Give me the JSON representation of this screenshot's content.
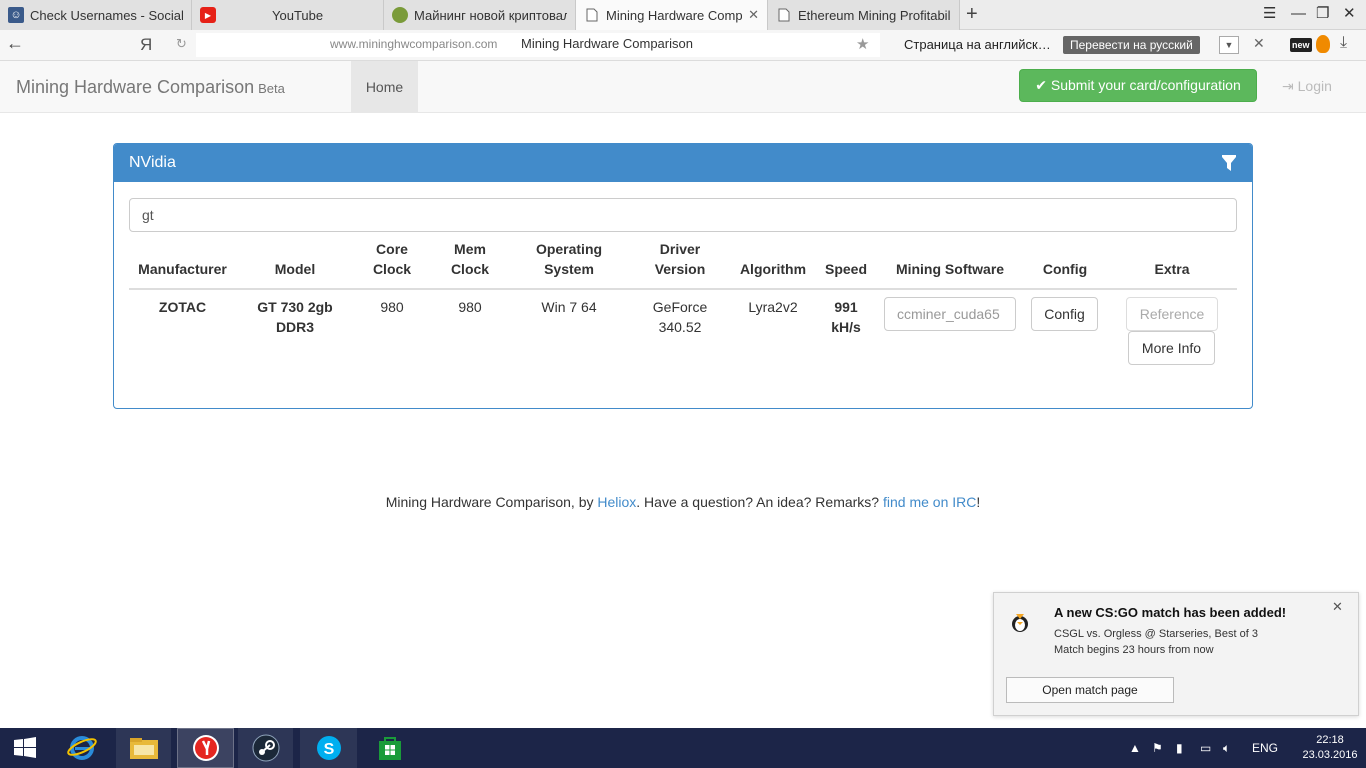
{
  "browser": {
    "tabs": [
      {
        "label": "Check Usernames - Social Me",
        "icon": "social-favicon",
        "active": false
      },
      {
        "label": "YouTube",
        "icon": "youtube-favicon",
        "active": false
      },
      {
        "label": "Майнинг новой криптовалю",
        "icon": "pepe-favicon",
        "active": false
      },
      {
        "label": "Mining Hardware Compar",
        "icon": "page-favicon",
        "active": true
      },
      {
        "label": "Ethereum Mining Profitability",
        "icon": "page-favicon",
        "active": false
      }
    ],
    "address": {
      "yandex_letter": "Я",
      "domain": "www.mininghwcomparison.com",
      "page_title": "Mining Hardware Comparison"
    },
    "translate": {
      "text": "Страница на английск…",
      "button": "Перевести на русский"
    },
    "ext_new": "new"
  },
  "navbar": {
    "brand": "Mining Hardware Comparison",
    "beta": "Beta",
    "home": "Home",
    "submit": "✔ Submit your card/configuration",
    "login": "Login"
  },
  "panel": {
    "title": "NVidia",
    "search_value": "gt",
    "headers": {
      "manufacturer": "Manufacturer",
      "model": "Model",
      "core_clock_1": "Core",
      "core_clock_2": "Clock",
      "mem_clock_1": "Mem",
      "mem_clock_2": "Clock",
      "os_1": "Operating",
      "os_2": "System",
      "driver_1": "Driver",
      "driver_2": "Version",
      "algorithm": "Algorithm",
      "speed": "Speed",
      "software": "Mining Software",
      "config": "Config",
      "extra": "Extra"
    },
    "row": {
      "manufacturer": "ZOTAC",
      "model_1": "GT 730 2gb",
      "model_2": "DDR3",
      "core_clock": "980",
      "mem_clock": "980",
      "os": "Win 7 64",
      "driver_1": "GeForce",
      "driver_2": "340.52",
      "algorithm": "Lyra2v2",
      "speed_1": "991",
      "speed_2": "kH/s",
      "software": "ccminer_cuda65",
      "config_button": "Config",
      "reference_button": "Reference",
      "more_info_button": "More Info"
    }
  },
  "footer": {
    "prefix": "Mining Hardware Comparison, by ",
    "author": "Heliox",
    "middle": ". Have a question? An idea? Remarks? ",
    "irc": "find me on IRC",
    "suffix": "!"
  },
  "notification": {
    "title": "A new CS:GO match has been added!",
    "line1": "CSGL vs. Orgless @ Starseries, Best of 3",
    "line2": "Match begins 23 hours from now",
    "button": "Open match page"
  },
  "taskbar": {
    "lang": "ENG",
    "time": "22:18",
    "date": "23.03.2016"
  },
  "colors": {
    "panel_primary": "#428bca",
    "success": "#5cb85c",
    "taskbar": "#1c2548"
  }
}
